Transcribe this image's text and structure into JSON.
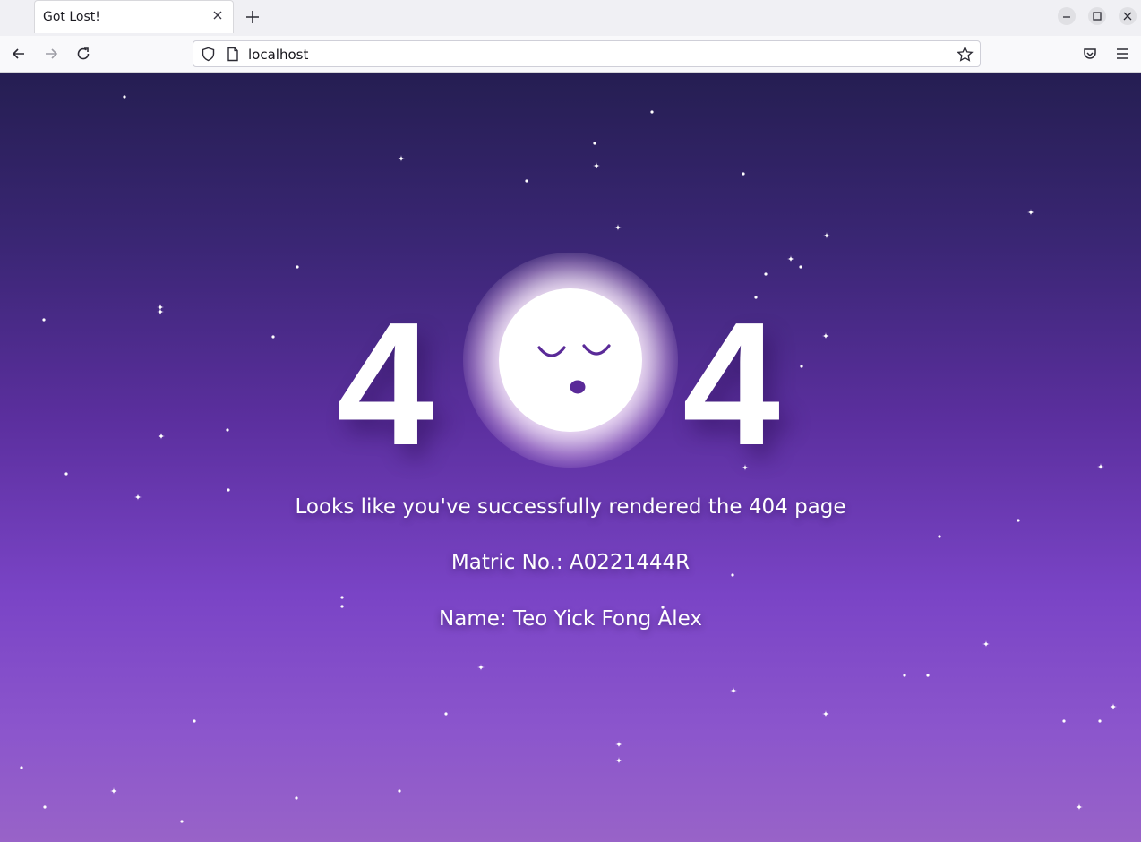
{
  "browser": {
    "tab_title": "Got Lost!",
    "url": "localhost"
  },
  "page": {
    "error_code_left_digit": "4",
    "error_code_right_digit": "4",
    "message": "Looks like you've successfully rendered the 404 page",
    "matric": "Matric No.: A0221444R",
    "name": "Name: Teo Yick Fong Alex"
  }
}
